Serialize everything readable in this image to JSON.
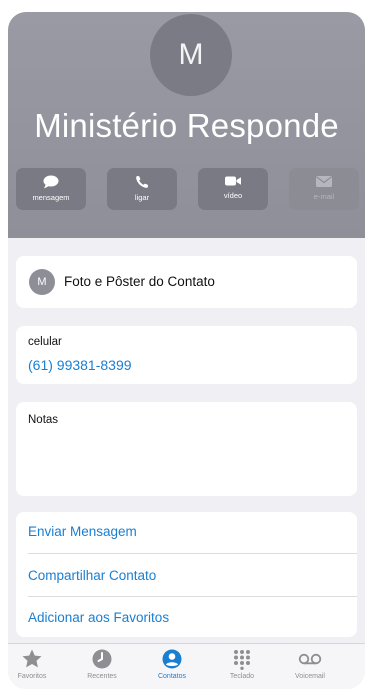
{
  "contact": {
    "initial": "M",
    "name": "Ministério Responde"
  },
  "actions": [
    {
      "label": "mensagem",
      "icon": "message-bubble-icon",
      "enabled": true
    },
    {
      "label": "ligar",
      "icon": "phone-icon",
      "enabled": true
    },
    {
      "label": "vídeo",
      "icon": "video-camera-icon",
      "enabled": true
    },
    {
      "label": "e-mail",
      "icon": "envelope-icon",
      "enabled": false
    }
  ],
  "poster": {
    "initial": "M",
    "label": "Foto e Pôster do Contato"
  },
  "phone": {
    "label": "celular",
    "number": "(61) 99381-8399"
  },
  "notes": {
    "label": "Notas",
    "value": ""
  },
  "links": [
    {
      "label": "Enviar Mensagem"
    },
    {
      "label": "Compartilhar Contato"
    },
    {
      "label": "Adicionar aos Favoritos"
    }
  ],
  "tabs": [
    {
      "label": "Favoritos",
      "icon": "star-icon",
      "active": false
    },
    {
      "label": "Recentes",
      "icon": "clock-icon",
      "active": false
    },
    {
      "label": "Contatos",
      "icon": "person-circle-icon",
      "active": true
    },
    {
      "label": "Teclado",
      "icon": "keypad-icon",
      "active": false
    },
    {
      "label": "Voicemail",
      "icon": "voicemail-icon",
      "active": false
    }
  ],
  "colors": {
    "header_gray": "#9a9aa4",
    "link_blue": "#1a7fd1",
    "inactive_tab": "#8e8e93"
  }
}
